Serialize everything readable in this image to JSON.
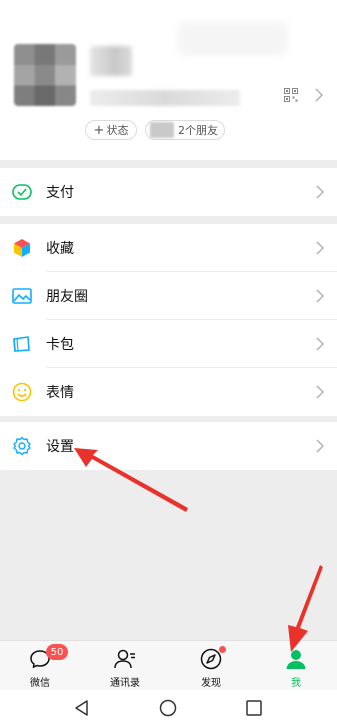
{
  "profile": {
    "status_plus": "+",
    "status_label": "状态",
    "friends_label": "2个朋友"
  },
  "menu": {
    "pay": "支付",
    "favorites": "收藏",
    "moments": "朋友圈",
    "cards": "卡包",
    "stickers": "表情",
    "settings": "设置"
  },
  "bottom_nav": {
    "chats": "微信",
    "chats_badge": "50",
    "contacts": "通讯录",
    "discover": "发现",
    "me": "我"
  },
  "colors": {
    "accent": "#07c160",
    "badge": "#fa5151",
    "arrow": "#e8322b"
  }
}
